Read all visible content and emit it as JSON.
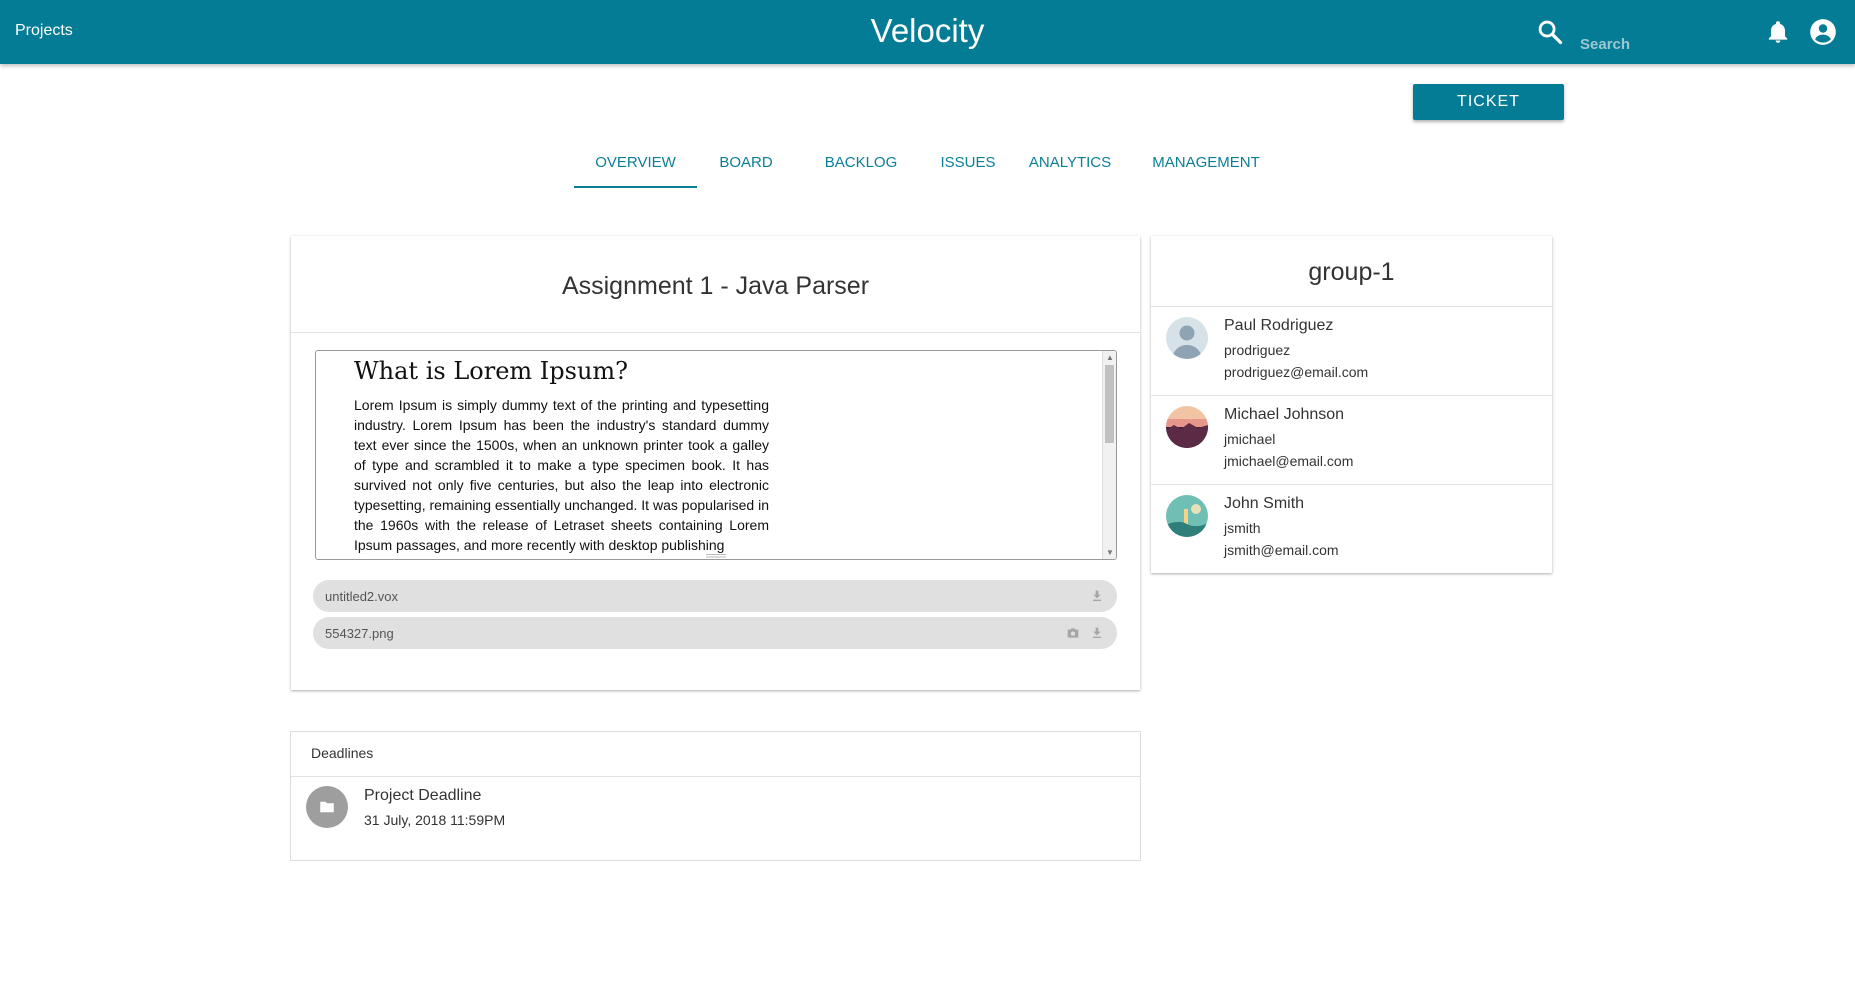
{
  "topbar": {
    "projects_label": "Projects",
    "brand": "Velocity",
    "search_placeholder": "Search",
    "search_icon": "search-icon",
    "notifications_icon": "bell-icon",
    "account_icon": "account-circle-icon"
  },
  "actions": {
    "ticket_label": "TICKET"
  },
  "tabs": [
    {
      "label": "OVERVIEW",
      "active": true
    },
    {
      "label": "BOARD",
      "active": false
    },
    {
      "label": "BACKLOG",
      "active": false
    },
    {
      "label": "ISSUES",
      "active": false
    },
    {
      "label": "ANALYTICS",
      "active": false
    },
    {
      "label": "MANAGEMENT",
      "active": false
    }
  ],
  "assignment": {
    "title": "Assignment 1 - Java Parser",
    "doc_heading": "What is Lorem Ipsum?",
    "doc_body": "Lorem Ipsum is simply dummy text of the printing and typesetting industry. Lorem Ipsum has been the industry's standard dummy text ever since the 1500s, when an unknown printer took a galley of type and scrambled it to make a type specimen book. It has survived not only five centuries, but also the leap into electronic typesetting, remaining essentially unchanged. It was popularised in the 1960s with the release of Letraset sheets containing Lorem Ipsum passages, and more recently with desktop publishing",
    "attachments": [
      {
        "name": "untitled2.vox",
        "icons": [
          "download-icon"
        ]
      },
      {
        "name": "554327.png",
        "icons": [
          "camera-icon",
          "download-icon"
        ]
      }
    ]
  },
  "group": {
    "name": "group-1",
    "members": [
      {
        "name": "Paul Rodriguez",
        "username": "prodriguez",
        "email": "prodriguez@email.com",
        "avatar": "default-person-avatar"
      },
      {
        "name": "Michael Johnson",
        "username": "jmichael",
        "email": "jmichael@email.com",
        "avatar": "sunset-avatar"
      },
      {
        "name": "John Smith",
        "username": "jsmith",
        "email": "jsmith@email.com",
        "avatar": "teal-landscape-avatar"
      }
    ]
  },
  "deadlines": {
    "header": "Deadlines",
    "items": [
      {
        "title": "Project Deadline",
        "date": "31 July, 2018 11:59PM",
        "icon": "folder-icon"
      }
    ]
  },
  "colors": {
    "primary": "#047c95",
    "tab_text": "#0a7f96",
    "chip_bg": "#e0e0e0"
  }
}
